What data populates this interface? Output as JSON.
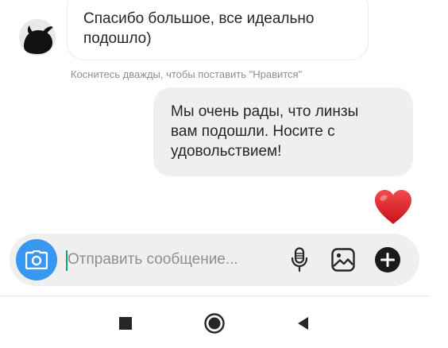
{
  "conversation": {
    "incoming_message": "Спасибо большое, все идеально\nподошло)",
    "like_hint": "Коснитесь дважды, чтобы поставить \"Нравится\"",
    "outgoing_message": "Мы очень рады, что линзы\nвам подошли. Носите с\nудовольствием!",
    "reaction": "heart-icon"
  },
  "composer": {
    "placeholder": "Отправить сообщение...",
    "value": "",
    "camera_icon": "camera-icon",
    "mic_icon": "microphone-icon",
    "gallery_icon": "image-icon",
    "add_icon": "plus-icon"
  },
  "navbar": {
    "recent_icon": "square-icon",
    "home_icon": "circle-icon",
    "back_icon": "triangle-back-icon"
  },
  "colors": {
    "accent": "#3897f0",
    "heart": "#e0202a",
    "bubble_out": "#efefef",
    "hint_text": "#8e8e8e",
    "caret": "#10a37f"
  }
}
